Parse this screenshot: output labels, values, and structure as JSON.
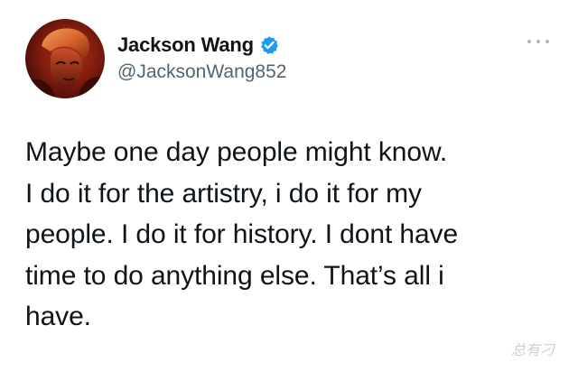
{
  "tweet": {
    "author": {
      "display_name": "Jackson Wang",
      "handle": "@JacksonWang852",
      "verified": true,
      "avatar_icon": "user-avatar-photo"
    },
    "menu_icon": "more-horizontal-icon",
    "text_lines": [
      "Maybe one day people might know.",
      "I do it for the artistry, i do it for my",
      "people. I do it for history. I dont have",
      "time to do anything else. That’s all i",
      "have."
    ]
  },
  "watermark": {
    "text": "总有刁"
  },
  "colors": {
    "text_primary": "#0f1419",
    "text_secondary": "#536471",
    "verified_badge": "#1d9bf0",
    "dots": "#aab8c2",
    "background": "#ffffff"
  }
}
